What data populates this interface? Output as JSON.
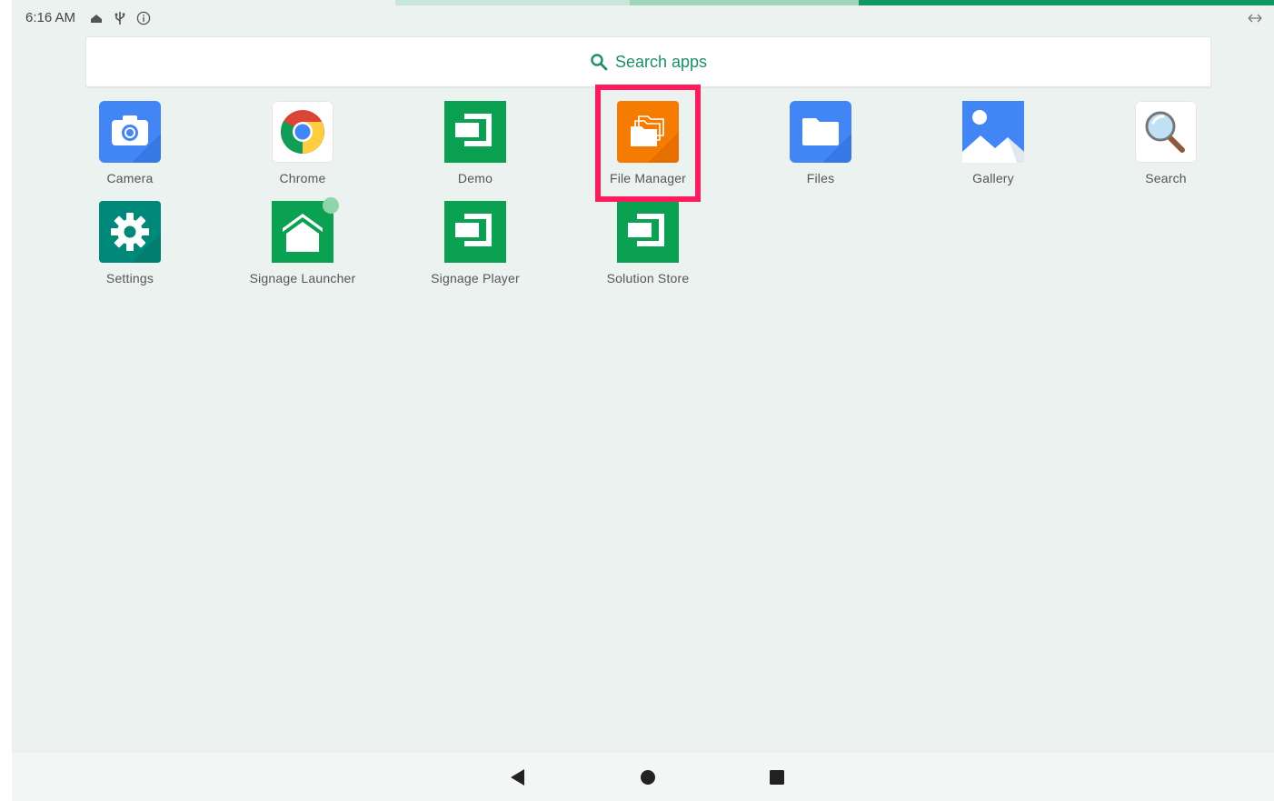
{
  "status_bar": {
    "time": "6:16 AM",
    "icons": [
      "home-notification-icon",
      "usb-icon",
      "info-icon"
    ],
    "right_icon": "resize-arrows-icon"
  },
  "search": {
    "placeholder": "Search apps",
    "icon": "search-icon"
  },
  "apps": [
    {
      "label": "Camera",
      "icon": "camera-icon"
    },
    {
      "label": "Chrome",
      "icon": "chrome-icon"
    },
    {
      "label": "Demo",
      "icon": "demo-icon"
    },
    {
      "label": "File Manager",
      "icon": "file-manager-icon"
    },
    {
      "label": "Files",
      "icon": "files-icon"
    },
    {
      "label": "Gallery",
      "icon": "gallery-icon"
    },
    {
      "label": "Search",
      "icon": "search-app-icon"
    },
    {
      "label": "Settings",
      "icon": "settings-icon"
    },
    {
      "label": "Signage Launcher",
      "icon": "signage-launcher-icon"
    },
    {
      "label": "Signage Player",
      "icon": "signage-player-icon"
    },
    {
      "label": "Solution Store",
      "icon": "solution-store-icon"
    }
  ],
  "nav": {
    "back": "back-icon",
    "home": "home-icon",
    "recents": "recents-icon"
  },
  "colors": {
    "accent": "#1e8e6e",
    "highlight": "#ff1a5e",
    "background": "#ecf2ef",
    "signage_green": "#0aa152"
  }
}
